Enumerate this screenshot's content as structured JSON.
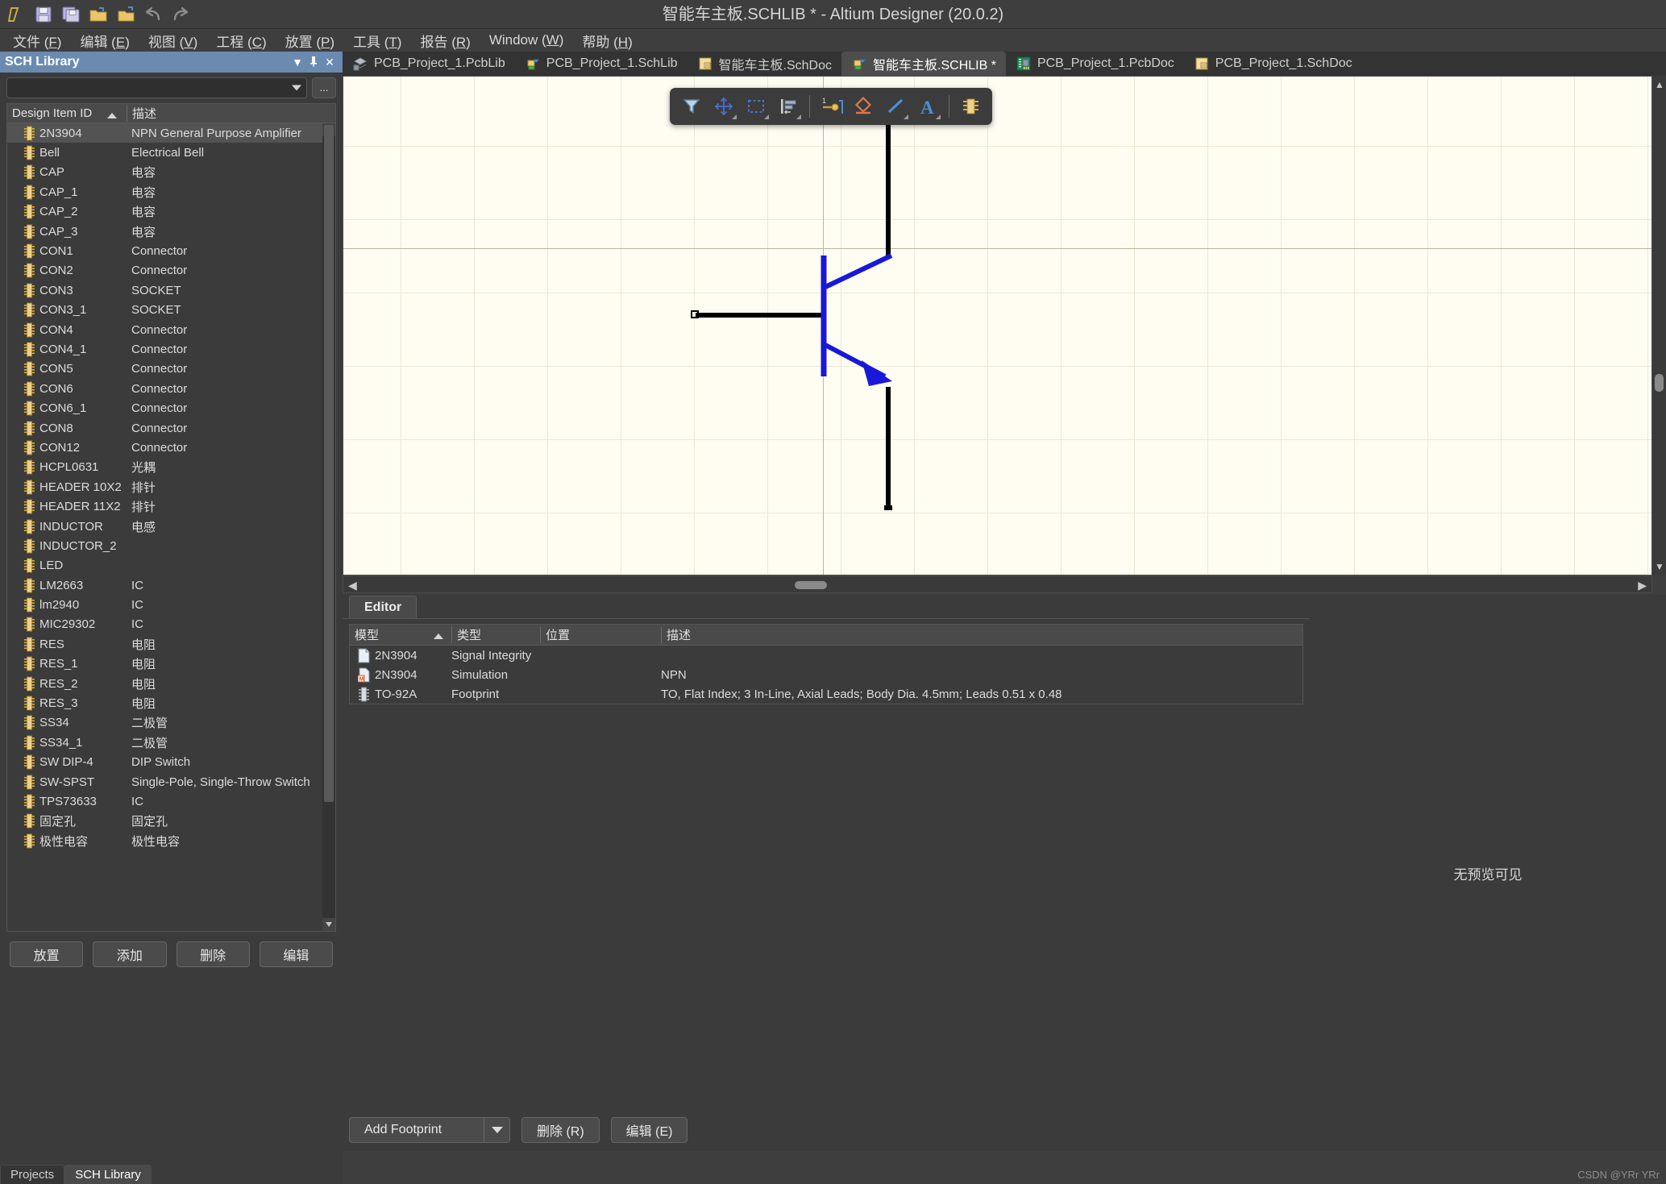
{
  "window": {
    "title": "智能车主板.SCHLIB * - Altium Designer (20.0.2)"
  },
  "quick_access": [
    {
      "name": "altium-logo-icon",
      "label": "A"
    },
    {
      "name": "save-icon",
      "label": "Save"
    },
    {
      "name": "save-all-icon",
      "label": "Save All"
    },
    {
      "name": "open-folder-icon",
      "label": "Open"
    },
    {
      "name": "open-document-icon",
      "label": "Open Document"
    },
    {
      "name": "undo-icon",
      "label": "Undo"
    },
    {
      "name": "redo-icon",
      "label": "Redo"
    }
  ],
  "menubar": [
    {
      "label": "文件",
      "key": "F"
    },
    {
      "label": "编辑",
      "key": "E"
    },
    {
      "label": "视图",
      "key": "V"
    },
    {
      "label": "工程",
      "key": "C"
    },
    {
      "label": "放置",
      "key": "P"
    },
    {
      "label": "工具",
      "key": "T"
    },
    {
      "label": "报告",
      "key": "R"
    },
    {
      "label": "Window",
      "key": "W"
    },
    {
      "label": "帮助",
      "key": "H"
    }
  ],
  "panel": {
    "title": "SCH Library",
    "buttons": {
      "dropdown": "▼",
      "pin": "📌",
      "close": "✕"
    },
    "filter_value": "",
    "more_button": "...",
    "columns": {
      "id": "Design Item ID",
      "description": "描述"
    },
    "items": [
      {
        "id": "2N3904",
        "description": "NPN General Purpose Amplifier",
        "selected": true
      },
      {
        "id": "Bell",
        "description": "Electrical Bell",
        "selected": false
      },
      {
        "id": "CAP",
        "description": "电容",
        "selected": false
      },
      {
        "id": "CAP_1",
        "description": "电容",
        "selected": false
      },
      {
        "id": "CAP_2",
        "description": "电容",
        "selected": false
      },
      {
        "id": "CAP_3",
        "description": "电容",
        "selected": false
      },
      {
        "id": "CON1",
        "description": "Connector",
        "selected": false
      },
      {
        "id": "CON2",
        "description": "Connector",
        "selected": false
      },
      {
        "id": "CON3",
        "description": "SOCKET",
        "selected": false
      },
      {
        "id": "CON3_1",
        "description": "SOCKET",
        "selected": false
      },
      {
        "id": "CON4",
        "description": "Connector",
        "selected": false
      },
      {
        "id": "CON4_1",
        "description": "Connector",
        "selected": false
      },
      {
        "id": "CON5",
        "description": "Connector",
        "selected": false
      },
      {
        "id": "CON6",
        "description": "Connector",
        "selected": false
      },
      {
        "id": "CON6_1",
        "description": "Connector",
        "selected": false
      },
      {
        "id": "CON8",
        "description": "Connector",
        "selected": false
      },
      {
        "id": "CON12",
        "description": "Connector",
        "selected": false
      },
      {
        "id": "HCPL0631",
        "description": "光耦",
        "selected": false
      },
      {
        "id": "HEADER 10X2",
        "description": "排针",
        "selected": false
      },
      {
        "id": "HEADER 11X2",
        "description": "排针",
        "selected": false
      },
      {
        "id": "INDUCTOR",
        "description": "电感",
        "selected": false
      },
      {
        "id": "INDUCTOR_2",
        "description": "",
        "selected": false
      },
      {
        "id": "LED",
        "description": "",
        "selected": false
      },
      {
        "id": "LM2663",
        "description": "IC",
        "selected": false
      },
      {
        "id": "lm2940",
        "description": "IC",
        "selected": false
      },
      {
        "id": "MIC29302",
        "description": "IC",
        "selected": false
      },
      {
        "id": "RES",
        "description": "电阻",
        "selected": false
      },
      {
        "id": "RES_1",
        "description": "电阻",
        "selected": false
      },
      {
        "id": "RES_2",
        "description": "电阻",
        "selected": false
      },
      {
        "id": "RES_3",
        "description": "电阻",
        "selected": false
      },
      {
        "id": "SS34",
        "description": "二极管",
        "selected": false
      },
      {
        "id": "SS34_1",
        "description": "二极管",
        "selected": false
      },
      {
        "id": "SW DIP-4",
        "description": "DIP Switch",
        "selected": false
      },
      {
        "id": "SW-SPST",
        "description": "Single-Pole, Single-Throw Switch",
        "selected": false
      },
      {
        "id": "TPS73633",
        "description": "IC",
        "selected": false
      },
      {
        "id": "固定孔",
        "description": "固定孔",
        "selected": false
      },
      {
        "id": "极性电容",
        "description": "极性电容",
        "selected": false
      }
    ],
    "actions": [
      {
        "label": "放置",
        "name": "place-button"
      },
      {
        "label": "添加",
        "name": "add-button"
      },
      {
        "label": "删除",
        "name": "delete-button"
      },
      {
        "label": "编辑",
        "name": "edit-button"
      }
    ],
    "bottom_tabs": [
      {
        "label": "Projects",
        "active": false
      },
      {
        "label": "SCH Library",
        "active": true
      }
    ]
  },
  "document_tabs": [
    {
      "label": "PCB_Project_1.PcbLib",
      "icon": "pcblib-icon",
      "active": false
    },
    {
      "label": "PCB_Project_1.SchLib",
      "icon": "schlib-icon",
      "active": false
    },
    {
      "label": "智能车主板.SchDoc",
      "icon": "schdoc-icon",
      "active": false
    },
    {
      "label": "智能车主板.SCHLIB *",
      "icon": "schlib-icon",
      "active": true
    },
    {
      "label": "PCB_Project_1.PcbDoc",
      "icon": "pcbdoc-icon",
      "active": false
    },
    {
      "label": "PCB_Project_1.SchDoc",
      "icon": "schdoc-icon",
      "active": false
    }
  ],
  "canvas_toolbar": [
    {
      "name": "filter-icon",
      "label": "Filter"
    },
    {
      "name": "move-cross-icon",
      "label": "Move"
    },
    {
      "name": "select-rectangle-icon",
      "label": "Select Area"
    },
    {
      "name": "align-icon",
      "label": "Align"
    },
    {
      "name": "place-pin-icon",
      "label": "Place Pin"
    },
    {
      "name": "place-shape-icon",
      "label": "Place Shape"
    },
    {
      "name": "place-line-icon",
      "label": "Place Line"
    },
    {
      "name": "place-text-icon",
      "label": "Place Text"
    },
    {
      "name": "place-component-icon",
      "label": "Place Component"
    }
  ],
  "editor": {
    "tab_label": "Editor",
    "columns": {
      "model": "模型",
      "type": "类型",
      "location": "位置",
      "description": "描述"
    },
    "rows": [
      {
        "model": "2N3904",
        "type": "Signal Integrity",
        "location": "",
        "description": "",
        "icon": "si-model-icon"
      },
      {
        "model": "2N3904",
        "type": "Simulation",
        "location": "",
        "description": "NPN",
        "icon": "sim-model-icon"
      },
      {
        "model": "TO-92A",
        "type": "Footprint",
        "location": "",
        "description": "TO, Flat Index; 3 In-Line, Axial Leads; Body Dia. 4.5mm; Leads 0.51 x 0.48",
        "icon": "footprint-model-icon"
      }
    ],
    "actions": [
      {
        "label": "Add Footprint",
        "name": "add-footprint-button",
        "split": true
      },
      {
        "label": "删除 (R)",
        "name": "delete-model-button",
        "split": false
      },
      {
        "label": "编辑 (E)",
        "name": "edit-model-button",
        "split": false
      }
    ]
  },
  "preview": {
    "message": "无预览可见"
  },
  "watermark": "CSDN @YRr YRr",
  "colors": {
    "panel_header": "#6b8ab0",
    "canvas_bg": "#fffdf2",
    "symbol_blue": "#1818d8",
    "symbol_black": "#000000",
    "window_bg": "#3e3e3e"
  }
}
